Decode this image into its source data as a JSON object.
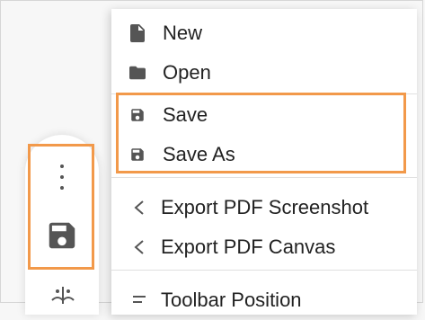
{
  "menu": {
    "items": [
      {
        "label": "New",
        "icon": "file-icon"
      },
      {
        "label": "Open",
        "icon": "folder-icon"
      },
      {
        "label": "Save",
        "icon": "save-icon"
      },
      {
        "label": "Save As",
        "icon": "save-as-icon"
      },
      {
        "label": "Export PDF Screenshot",
        "icon": "share-icon"
      },
      {
        "label": "Export PDF Canvas",
        "icon": "share-icon"
      },
      {
        "label": "Toolbar Position",
        "icon": "toolbar-position-icon"
      }
    ]
  },
  "toolbar": {
    "buttons": [
      {
        "icon": "more-vertical-icon"
      },
      {
        "icon": "save-icon"
      },
      {
        "icon": "tool-icon"
      }
    ]
  },
  "colors": {
    "highlight": "#f2994a",
    "menu_background": "#ffffff",
    "text": "#222222",
    "icon": "#555555"
  }
}
